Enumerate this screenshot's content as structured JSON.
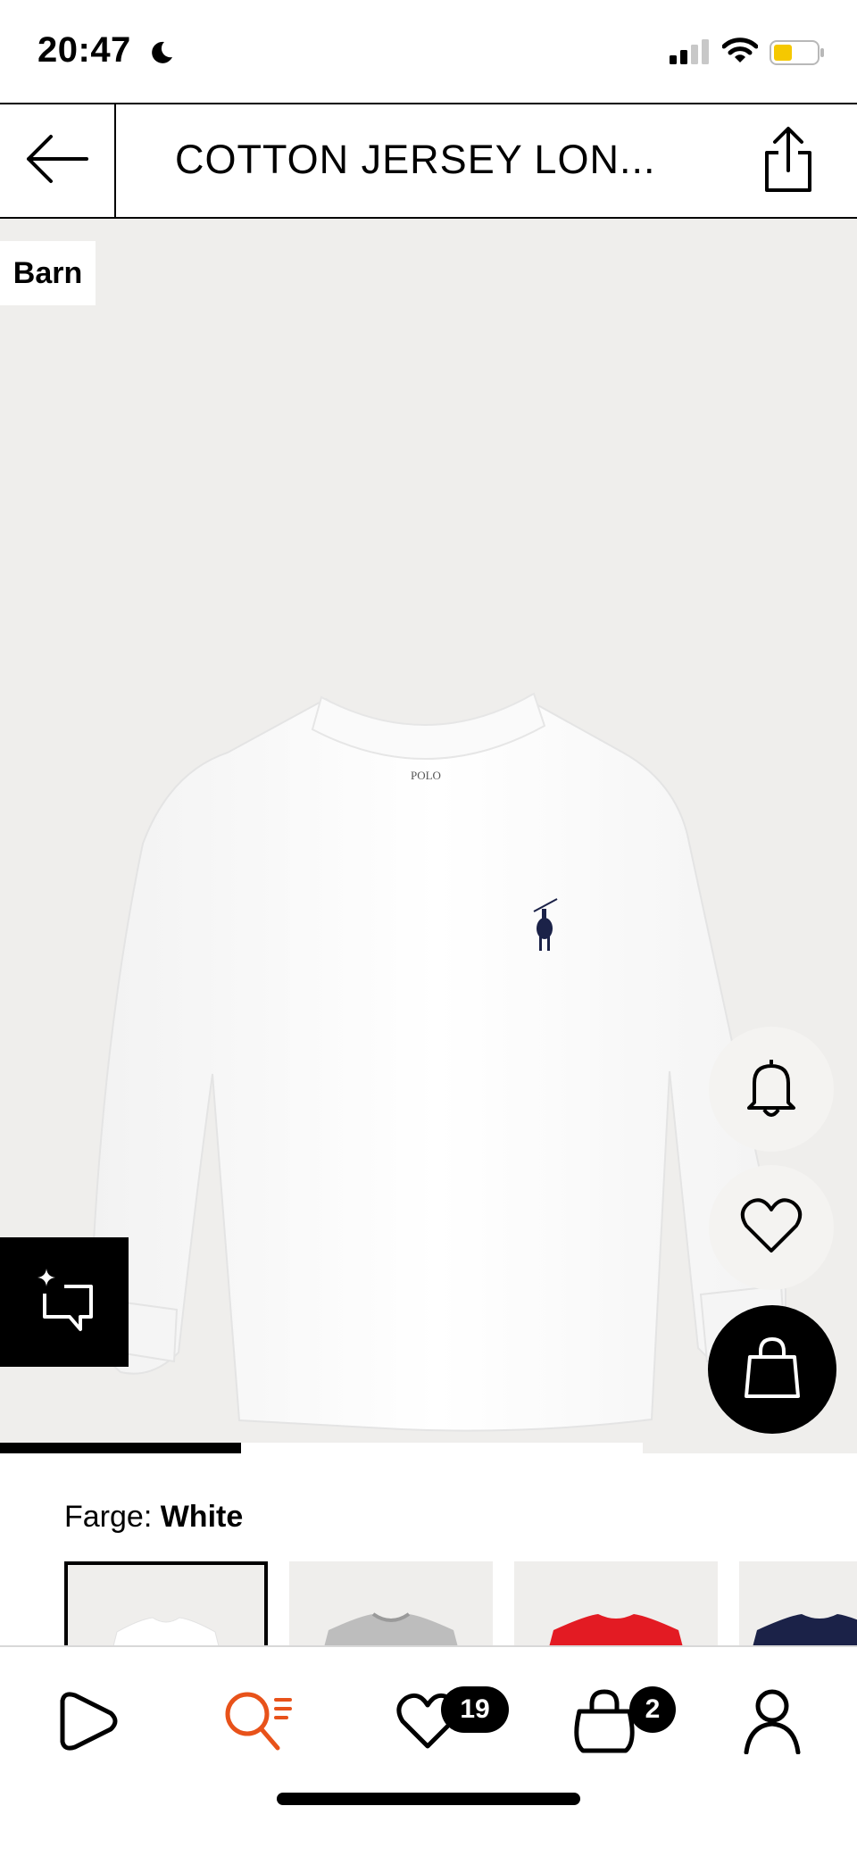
{
  "status_bar": {
    "time": "20:47"
  },
  "header": {
    "title": "COTTON JERSEY LON..."
  },
  "product": {
    "category_badge": "Barn",
    "logo_text": "POLO",
    "image_progress": 0.375
  },
  "color": {
    "label": "Farge:",
    "value": "White",
    "swatches": [
      "White",
      "Grey",
      "Red",
      "Navy"
    ],
    "swatch_colors": [
      "#ffffff",
      "#bfbfbf",
      "#e31b23",
      "#1b2248"
    ]
  },
  "nav": {
    "favorites_count": "19",
    "cart_count": "2"
  },
  "colors": {
    "accent": "#e8521a",
    "background": "#efeeec"
  }
}
